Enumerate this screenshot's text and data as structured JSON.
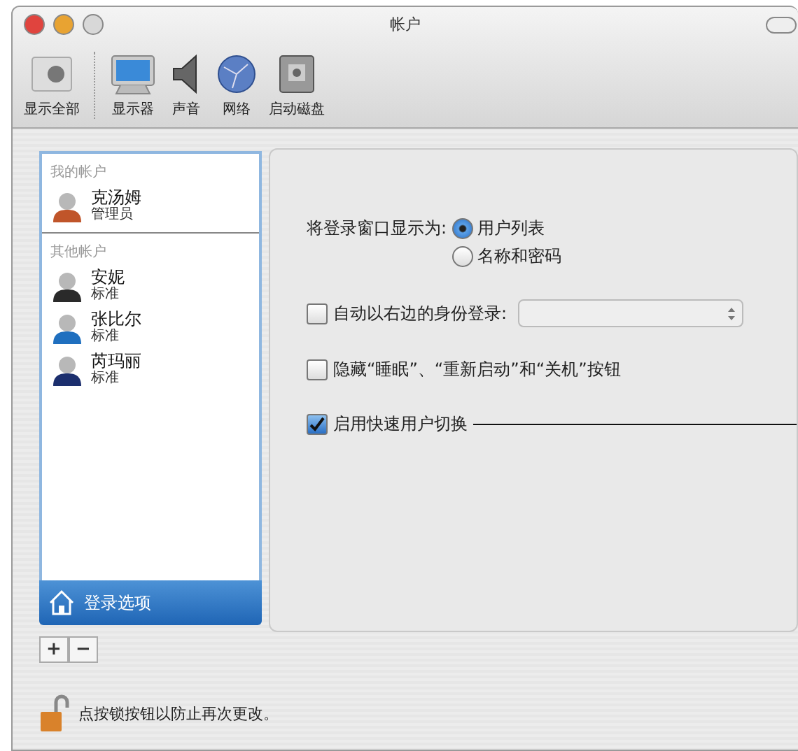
{
  "window": {
    "title": "帐户"
  },
  "toolbar": {
    "items": [
      {
        "kind": "showall",
        "label": "显示全部"
      },
      {
        "kind": "display",
        "label": "显示器"
      },
      {
        "kind": "sound",
        "label": "声音"
      },
      {
        "kind": "network",
        "label": "网络"
      },
      {
        "kind": "disk",
        "label": "启动磁盘"
      }
    ]
  },
  "sidebar": {
    "groups": [
      {
        "heading": "我的帐户",
        "users": [
          {
            "name": "克汤姆",
            "role": "管理员",
            "selected": false,
            "color": "#c0552a"
          }
        ]
      },
      {
        "heading": "其他帐户",
        "users": [
          {
            "name": "安妮",
            "role": "标准",
            "selected": false,
            "color": "#2a2a2a"
          },
          {
            "name": "张比尔",
            "role": "标准",
            "selected": false,
            "color": "#1f6fbf"
          },
          {
            "name": "芮玛丽",
            "role": "标准",
            "selected": false,
            "color": "#1c2f6e"
          }
        ]
      }
    ],
    "login_options": {
      "label": "登录选项",
      "selected": true
    }
  },
  "panel": {
    "display_as": {
      "label": "将登录窗口显示为:",
      "options": [
        {
          "label": "用户列表",
          "selected": true
        },
        {
          "label": "名称和密码",
          "selected": false
        }
      ]
    },
    "checkboxes": [
      {
        "kind": "dropdown",
        "label": "自动以右边的身份登录:",
        "checked": false
      },
      {
        "kind": "plain",
        "label": "隐藏“睡眠”、“重新启动”和“关机”按钮",
        "checked": false
      },
      {
        "kind": "callout",
        "label": "启用快速用户切换",
        "checked": true
      }
    ]
  },
  "list_buttons": [
    "+",
    "−"
  ],
  "lock": {
    "message": "点按锁按钮以防止再次更改。"
  }
}
